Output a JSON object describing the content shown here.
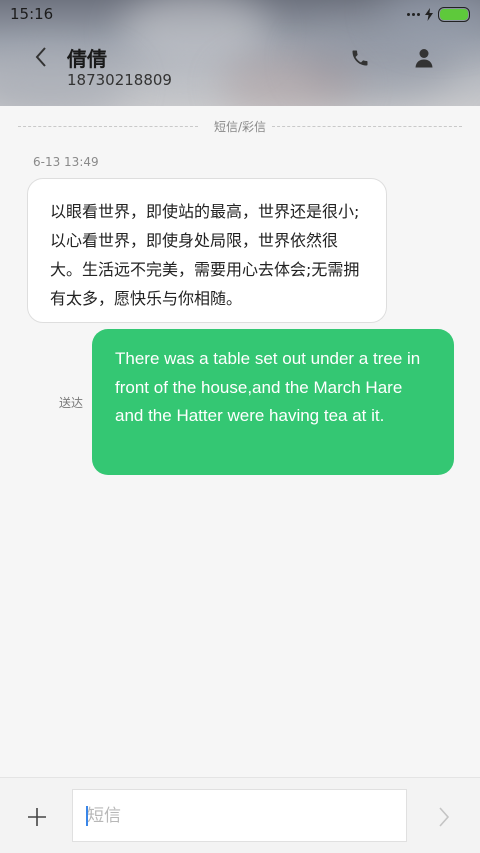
{
  "status_bar": {
    "time": "15:16",
    "battery_level_percent": 100,
    "battery_color": "#5ec93b",
    "icons": [
      "signal-dots-icon",
      "charging-bolt-icon",
      "battery-icon"
    ]
  },
  "header": {
    "contact_name": "倩倩",
    "contact_number": "18730218809",
    "icons": [
      "back-chevron-icon",
      "phone-icon",
      "person-icon"
    ]
  },
  "conversation": {
    "channel_label": "短信/彩信",
    "messages": [
      {
        "direction": "incoming",
        "timestamp": "6-13 13:49",
        "text": "以眼看世界，即使站的最高，世界还是很小;以心看世界，即使身处局限，世界依然很大。生活远不完美，需要用心去体会;无需拥有太多，愿快乐与你相随。"
      },
      {
        "direction": "outgoing",
        "status": "送达",
        "text": "There was a table set out under a tree in front of the house,and the March Hare and the Hatter were having tea at it.",
        "bubble_color": "#34c773"
      }
    ]
  },
  "composer": {
    "placeholder": "短信",
    "value": "",
    "icons": [
      "plus-icon",
      "send-chevron-icon"
    ]
  }
}
